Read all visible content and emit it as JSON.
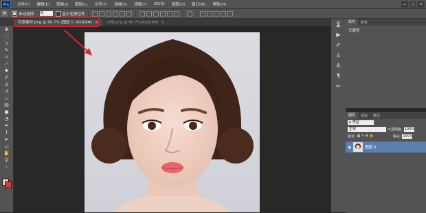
{
  "app": {
    "logo": "Ps"
  },
  "menu": [
    "文件(F)",
    "编辑(E)",
    "图像(I)",
    "图层(L)",
    "文字(Y)",
    "选择(S)",
    "滤镜(T)",
    "3D(D)",
    "视图(V)",
    "窗口(W)",
    "帮助(H)"
  ],
  "window_controls": [
    "−",
    "□",
    "×"
  ],
  "options": {
    "auto_select_label": "自动选择：",
    "auto_select_value": "组",
    "show_transform_label": "显示变换控件",
    "auto_select_checked": true,
    "show_transform_checked": false
  },
  "tabs": [
    {
      "label": "背景素材.png @ 66.7% (图层 0, RGB/8#)",
      "close": "×",
      "active": true
    },
    {
      "label": "人物.png @ 66.7%(RGB/8#)",
      "close": "×",
      "active": false
    }
  ],
  "toolbar_icons": [
    "move-icon",
    "marquee-icon",
    "lasso-icon",
    "quick-select-icon",
    "crop-icon",
    "eyedropper-icon",
    "healing-icon",
    "brush-icon",
    "stamp-icon",
    "history-brush-icon",
    "eraser-icon",
    "gradient-icon",
    "blur-icon",
    "dodge-icon",
    "pen-icon",
    "type-icon",
    "path-select-icon",
    "shape-icon",
    "hand-icon",
    "zoom-icon",
    "edit-mode-icon"
  ],
  "colors": {
    "foreground": "#d8d8d8",
    "background": "#e2323a",
    "highlight": "#e0262b",
    "selection": "#5d7fb0"
  },
  "properties": {
    "tabs": [
      "属性",
      "颜色"
    ],
    "text": "无属性"
  },
  "layers_panel": {
    "tabs": [
      "图层",
      "通道",
      "路径"
    ],
    "filter_label": "ρ 类型",
    "blend_mode": "正常",
    "opacity_label": "不透明度:",
    "opacity_value": "100%",
    "lock_label": "锁定:",
    "fill_label": "填充:",
    "fill_value": "100%",
    "layer_name": "图层 0"
  }
}
